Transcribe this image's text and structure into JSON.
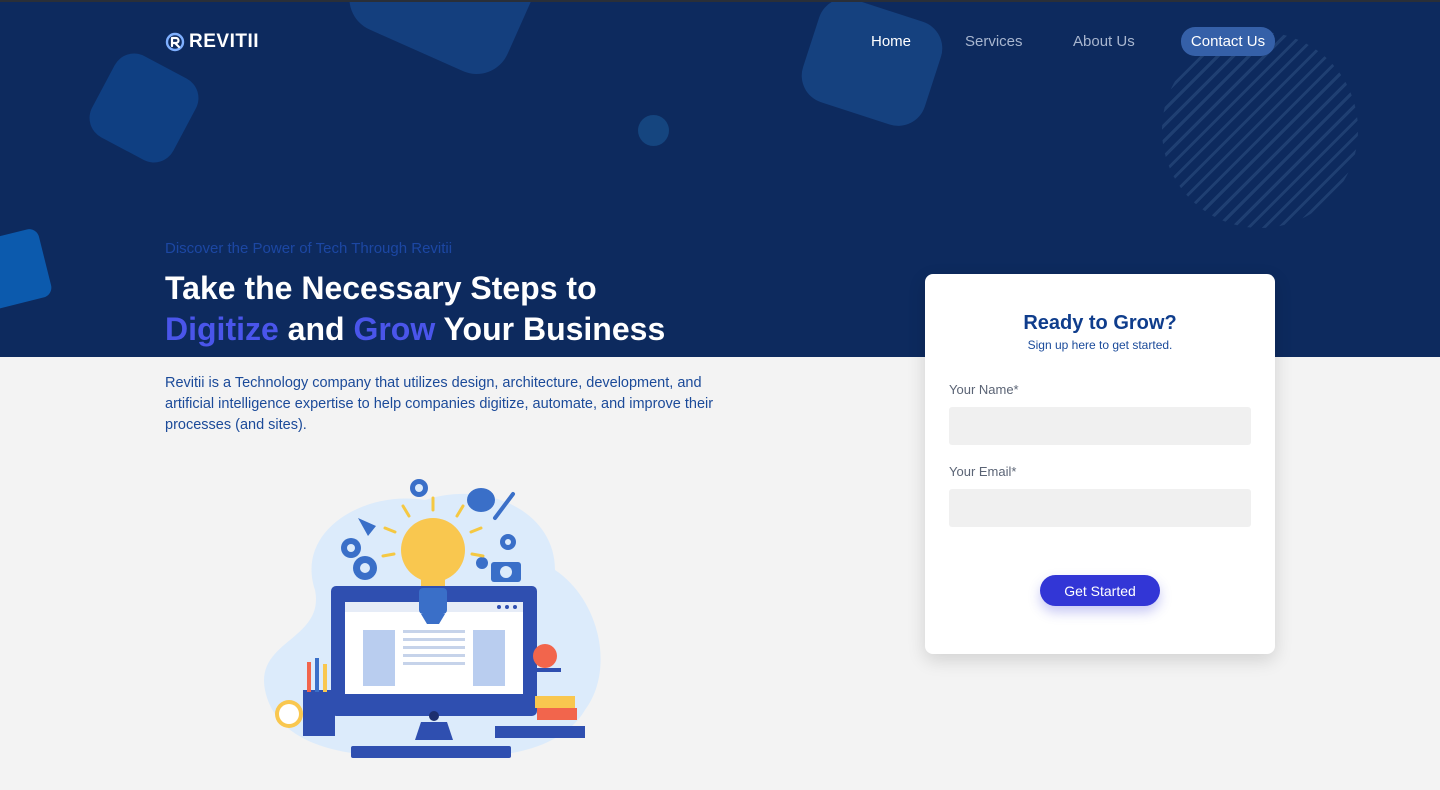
{
  "brand": {
    "name": "REVITII"
  },
  "nav": {
    "items": [
      {
        "label": "Home",
        "active": true
      },
      {
        "label": "Services",
        "active": false
      },
      {
        "label": "About Us",
        "active": false
      },
      {
        "label": "Contact Us",
        "active": false
      }
    ]
  },
  "hero": {
    "eyebrow": "Discover the Power of Tech Through Revitii",
    "headline_line1": "Take the Necessary Steps to",
    "headline_accent1": "Digitize",
    "headline_and": " and ",
    "headline_accent2": "Grow",
    "headline_tail": " Your Business",
    "description": "Revitii is a Technology company that utilizes design, architecture, development, and artificial intelligence expertise to help companies digitize, automate, and improve their processes (and sites).",
    "illustration_icon": "lightbulb-computer-illustration"
  },
  "form": {
    "title": "Ready to Grow?",
    "subtitle": "Sign up here to get started.",
    "name_label": "Your Name*",
    "name_value": "",
    "email_label": "Your Email*",
    "email_value": "",
    "submit_label": "Get Started"
  },
  "colors": {
    "hero_bg": "#0d2a5e",
    "page_bg": "#f3f3f3",
    "accent": "#4a55ea",
    "button": "#3236d6",
    "contact_pill": "#3560a8",
    "brand_blue": "#0f3d8c"
  }
}
